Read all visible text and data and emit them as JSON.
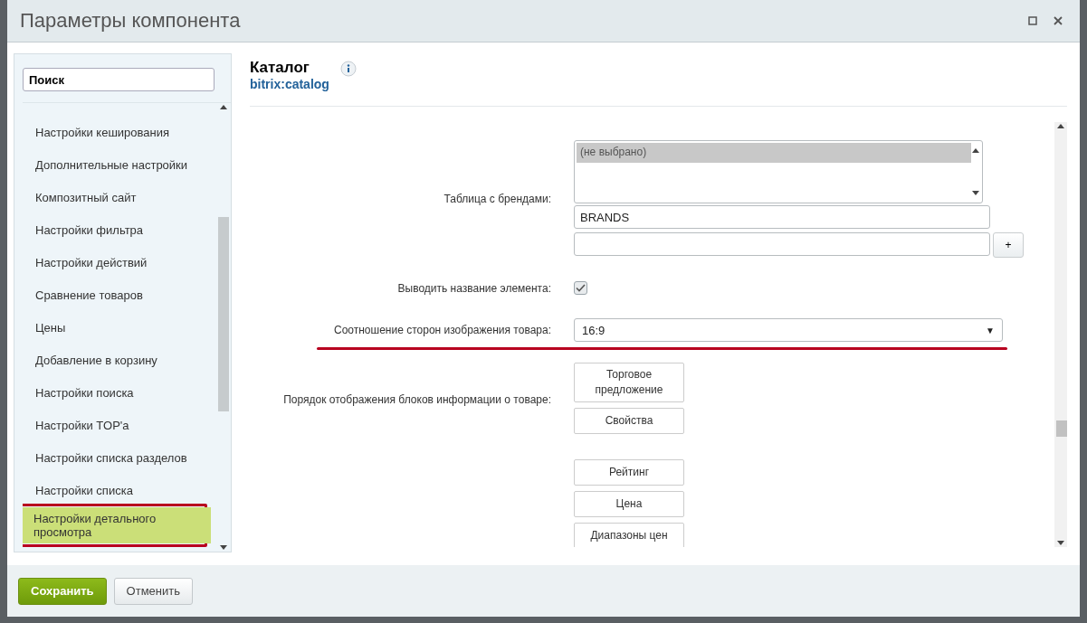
{
  "window": {
    "title": "Параметры компонента"
  },
  "sidebar": {
    "search": {
      "value": "Поиск"
    },
    "items": [
      {
        "label": "Настройки кеширования",
        "selected": false,
        "annotated": false
      },
      {
        "label": "Дополнительные настройки",
        "selected": false,
        "annotated": false
      },
      {
        "label": "Композитный сайт",
        "selected": false,
        "annotated": false
      },
      {
        "label": "Настройки фильтра",
        "selected": false,
        "annotated": false
      },
      {
        "label": "Настройки действий",
        "selected": false,
        "annotated": false
      },
      {
        "label": "Сравнение товаров",
        "selected": false,
        "annotated": false
      },
      {
        "label": "Цены",
        "selected": false,
        "annotated": false
      },
      {
        "label": "Добавление в корзину",
        "selected": false,
        "annotated": false
      },
      {
        "label": "Настройки поиска",
        "selected": false,
        "annotated": false
      },
      {
        "label": "Настройки TOP'a",
        "selected": false,
        "annotated": false
      },
      {
        "label": "Настройки списка разделов",
        "selected": false,
        "annotated": false
      },
      {
        "label": "Настройки списка",
        "selected": false,
        "annotated": false
      },
      {
        "label": "Настройки детального просмотра",
        "selected": true,
        "annotated": true
      }
    ]
  },
  "component": {
    "title": "Каталог",
    "code": "bitrix:catalog"
  },
  "fields": [
    {
      "kind": "brands",
      "label": "Таблица с брендами:",
      "options": [
        {
          "label": "(не выбрано)",
          "selected": true
        }
      ],
      "value": "BRANDS",
      "add_button": "+"
    },
    {
      "kind": "checkbox",
      "label": "Выводить название элемента:",
      "checked": true
    },
    {
      "kind": "select",
      "label": "Соотношение сторон изображения товара:",
      "value": "16:9",
      "arrow": "▼",
      "annotated": true
    },
    {
      "kind": "order",
      "label": "Порядок отображения блоков информации о товаре:",
      "groups": [
        [
          "Торговое предложение",
          "Свойства"
        ],
        [
          "Рейтинг",
          "Цена",
          "Диапазоны цен"
        ]
      ]
    }
  ],
  "footer": {
    "buttons": [
      {
        "label": "Сохранить",
        "kind": "primary"
      },
      {
        "label": "Отменить",
        "kind": "secondary"
      }
    ]
  }
}
